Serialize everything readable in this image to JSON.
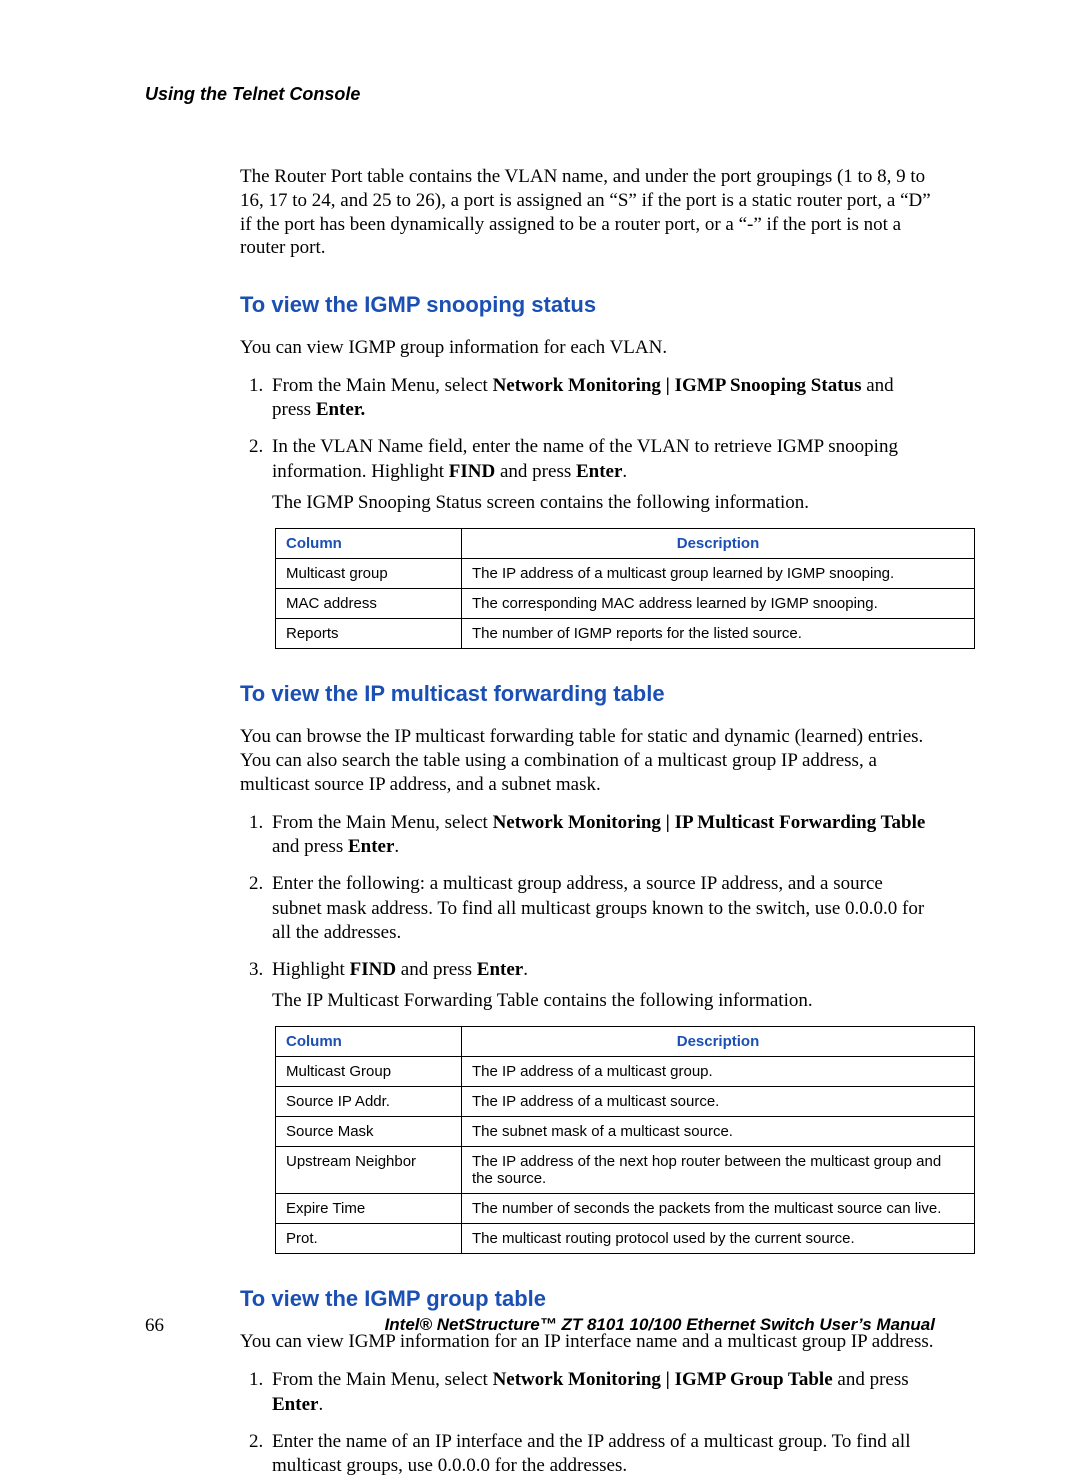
{
  "header": {
    "title": "Using the Telnet Console"
  },
  "intro": "The Router Port table contains the VLAN name, and under the port groupings (1 to 8, 9 to 16, 17 to 24, and 25 to 26), a port is assigned an “S” if the port is a static router port, a “D” if the port has been dynamically assigned to be a router port, or a “-” if the port is not a router port.",
  "sec1": {
    "heading": "To view the IGMP snooping status",
    "lead": "You can view IGMP group information for each VLAN.",
    "step1_pre": "From the Main Menu, select ",
    "step1_bold": "Network Monitoring | IGMP Snooping Status",
    "step1_mid": " and press ",
    "step1_bold2": "Enter.",
    "step2_pre": "In the VLAN Name field, enter the name of the VLAN to retrieve IGMP snooping information. Highlight ",
    "step2_bold": "FIND",
    "step2_mid": " and press ",
    "step2_bold2": "Enter",
    "step2_post": ".",
    "step2_after": "The IGMP Snooping Status screen contains the following information.",
    "table": {
      "h1": "Column",
      "h2": "Description",
      "rows": [
        {
          "c": "Multicast group",
          "d": "The IP address of a multicast group learned by IGMP snooping."
        },
        {
          "c": "MAC address",
          "d": "The corresponding MAC address learned by IGMP snooping."
        },
        {
          "c": "Reports",
          "d": "The number of IGMP reports for the listed source."
        }
      ]
    }
  },
  "sec2": {
    "heading": "To view the IP multicast forwarding table",
    "lead": "You can browse the IP multicast forwarding table for static and dynamic (learned) entries. You can also search the table using a combination of a multicast group IP address, a multicast source IP address, and a subnet mask.",
    "step1_pre": "From the Main Menu, select ",
    "step1_bold": "Network Monitoring | IP Multicast Forwarding Table",
    "step1_mid": " and press ",
    "step1_bold2": "Enter",
    "step1_post": ".",
    "step2": "Enter the following: a multicast group address, a source IP address, and a source subnet mask address. To find all multicast groups known to the switch, use 0.0.0.0 for all the addresses.",
    "step3_pre": "Highlight ",
    "step3_bold": "FIND",
    "step3_mid": " and press ",
    "step3_bold2": "Enter",
    "step3_post": ".",
    "step3_after": "The IP Multicast Forwarding Table contains the following information.",
    "table": {
      "h1": "Column",
      "h2": "Description",
      "rows": [
        {
          "c": "Multicast Group",
          "d": "The IP address of a multicast group."
        },
        {
          "c": "Source IP Addr.",
          "d": "The IP address of a multicast source."
        },
        {
          "c": "Source Mask",
          "d": "The subnet mask of a multicast source."
        },
        {
          "c": "Upstream Neighbor",
          "d": "The IP address of the next hop router between the multicast group and the source."
        },
        {
          "c": "Expire Time",
          "d": "The number of seconds the packets from the multicast source can live."
        },
        {
          "c": "Prot.",
          "d": "The multicast routing protocol used by the current source."
        }
      ]
    }
  },
  "sec3": {
    "heading": "To view the IGMP group table",
    "lead": "You can view IGMP information for an IP interface name and a multicast group IP address.",
    "step1_pre": "From the Main Menu, select ",
    "step1_bold": "Network Monitoring | IGMP Group Table",
    "step1_mid": " and press ",
    "step1_bold2": "Enter",
    "step1_post": ".",
    "step2": "Enter the name of an IP interface and the IP address of a multicast group. To find all multicast groups, use 0.0.0.0 for the addresses."
  },
  "footer": {
    "page": "66",
    "text": "Intel® NetStructure™  ZT 8101 10/100 Ethernet Switch User’s Manual"
  }
}
